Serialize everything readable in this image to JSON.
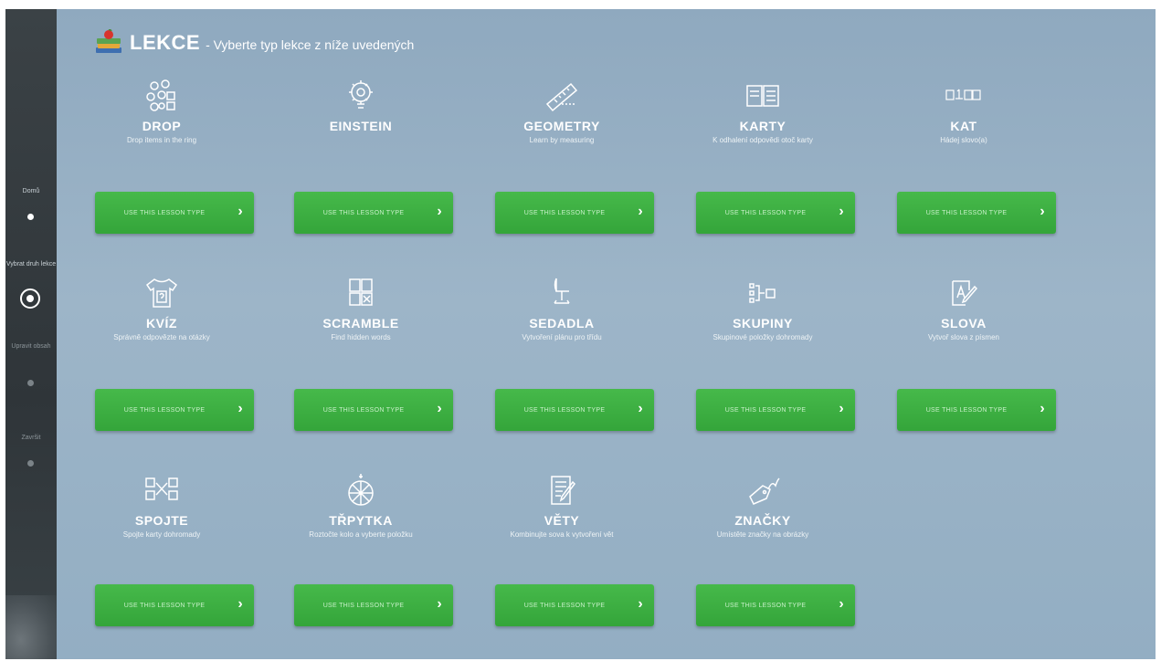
{
  "header": {
    "title": "LEKCE",
    "subtitle": "- Vyberte typ lekce z níže uvedených"
  },
  "sidebar": {
    "steps": [
      {
        "label": "Domů",
        "state": "done"
      },
      {
        "label": "Vybrat druh lekce",
        "state": "current"
      },
      {
        "label": "Upravit obsah",
        "state": "pending"
      },
      {
        "label": "Završit",
        "state": "pending"
      }
    ]
  },
  "button_label": "USE THIS LESSON TYPE",
  "lessons": [
    {
      "title": "DROP",
      "desc": "Drop items in the ring",
      "icon": "molecule-icon"
    },
    {
      "title": "EINSTEIN",
      "desc": "",
      "icon": "lightbulb-gear-icon"
    },
    {
      "title": "GEOMETRY",
      "desc": "Learn by measuring",
      "icon": "ruler-icon"
    },
    {
      "title": "KARTY",
      "desc": "K odhalení odpovědi otoč karty",
      "icon": "cards-icon"
    },
    {
      "title": "KAT",
      "desc": "Hádej slovo(a)",
      "icon": "letter-boxes-icon"
    },
    {
      "title": "KVÍZ",
      "desc": "Správně odpovězte na otázky",
      "icon": "shirt-question-icon"
    },
    {
      "title": "SCRAMBLE",
      "desc": "Find hidden words",
      "icon": "letter-grid-icon"
    },
    {
      "title": "SEDADLA",
      "desc": "Vytvoření plánu pro třídu",
      "icon": "chair-icon"
    },
    {
      "title": "SKUPINY",
      "desc": "Skupinové položky dohromady",
      "icon": "group-icon"
    },
    {
      "title": "SLOVA",
      "desc": "Vytvoř slova z písmen",
      "icon": "pen-letter-icon"
    },
    {
      "title": "SPOJTE",
      "desc": "Spojte karty dohromady",
      "icon": "connect-icon"
    },
    {
      "title": "TŘPYTKA",
      "desc": "Roztočte kolo a vyberte položku",
      "icon": "wheel-icon"
    },
    {
      "title": "VĚTY",
      "desc": "Kombinujte sova k vytvoření vět",
      "icon": "notepad-pen-icon"
    },
    {
      "title": "ZNAČKY",
      "desc": "Umístěte značky na obrázky",
      "icon": "tag-icon"
    }
  ]
}
